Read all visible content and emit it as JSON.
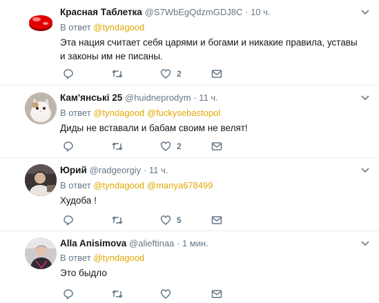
{
  "tweets": [
    {
      "name": "Красная Таблетка",
      "handle": "@S7WbEgQdzmGDJ8C",
      "time": "· 10 ч.",
      "reply_prefix": "В ответ",
      "mentions": [
        "@tyndagood"
      ],
      "text": "Эта нация считает себя царями и богами и никакие правила, уставы и законы им не писаны.",
      "likes": "2",
      "avatar": "red-pill-icon"
    },
    {
      "name": "Кам'янські 25",
      "handle": "@huidneprodym",
      "time": "· 11 ч.",
      "reply_prefix": "В ответ",
      "mentions": [
        "@tyndagood",
        "@fuckysebastopol"
      ],
      "text": "Диды не вставали и бабам своим не велят!",
      "likes": "2",
      "avatar": "cat-photo"
    },
    {
      "name": "Юрий",
      "handle": "@radgeorgiy",
      "time": "· 11 ч.",
      "reply_prefix": "В ответ",
      "mentions": [
        "@tyndagood",
        "@manya678499"
      ],
      "text": "Худоба !",
      "likes": "5",
      "avatar": "user-photo"
    },
    {
      "name": "Alla Anisimova",
      "handle": "@alieftinaa",
      "time": "· 1 мин.",
      "reply_prefix": "В ответ",
      "mentions": [
        "@tyndagood"
      ],
      "text": "Это быдло",
      "likes": "",
      "avatar": "user-photo"
    }
  ],
  "colors": {
    "mention": "#e0a800",
    "muted": "#657786",
    "divider": "#e6ecf0"
  }
}
